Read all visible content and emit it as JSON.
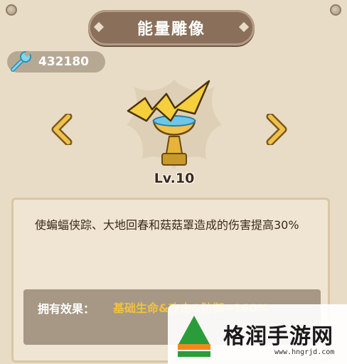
{
  "header": {
    "title": "能量雕像"
  },
  "currency": {
    "icon": "wrench-icon",
    "value": "432180"
  },
  "statue": {
    "level": "Lv.10"
  },
  "description": {
    "text": "使蝙蝠侠踪、大地回春和菇菇罩造成的伤害提高30%"
  },
  "effect": {
    "label": "拥有效果：",
    "value": "基础生命&攻击&防御+160%"
  },
  "watermark": {
    "title": "格润手游网",
    "url": "www.hngrjd.com"
  },
  "colors": {
    "banner": "#8a6f5a",
    "gold": "#f2c23e",
    "background": "#e9dcc6"
  }
}
